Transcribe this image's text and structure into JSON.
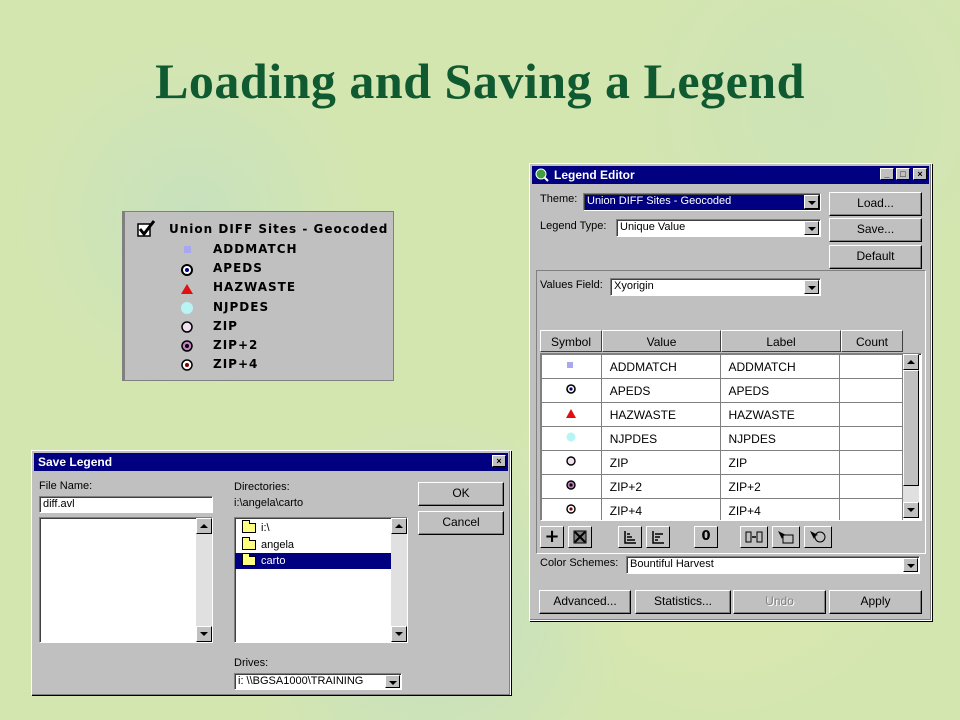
{
  "slide": {
    "title": "Loading and Saving a Legend"
  },
  "legend_display": {
    "title": "Union DIFF Sites - Geocoded",
    "items": [
      "ADDMATCH",
      "APEDS",
      "HAZWASTE",
      "NJPDES",
      "ZIP",
      "ZIP+2",
      "ZIP+4"
    ]
  },
  "legend_editor": {
    "window_title": "Legend Editor",
    "theme_label": "Theme:",
    "theme_value": "Union DIFF Sites - Geocoded",
    "legend_type_label": "Legend Type:",
    "legend_type_value": "Unique Value",
    "load_button": "Load...",
    "save_button": "Save...",
    "default_button": "Default",
    "values_field_label": "Values Field:",
    "values_field_value": "Xyorigin",
    "columns": [
      "Symbol",
      "Value",
      "Label",
      "Count"
    ],
    "rows": [
      {
        "value": "ADDMATCH",
        "label": "ADDMATCH",
        "count": ""
      },
      {
        "value": "APEDS",
        "label": "APEDS",
        "count": ""
      },
      {
        "value": "HAZWASTE",
        "label": "HAZWASTE",
        "count": ""
      },
      {
        "value": "NJPDES",
        "label": "NJPDES",
        "count": ""
      },
      {
        "value": "ZIP",
        "label": "ZIP",
        "count": ""
      },
      {
        "value": "ZIP+2",
        "label": "ZIP+2",
        "count": ""
      },
      {
        "value": "ZIP+4",
        "label": "ZIP+4",
        "count": ""
      }
    ],
    "tools": [
      "+",
      "0"
    ],
    "color_schemes_label": "Color Schemes:",
    "color_schemes_value": "Bountiful Harvest",
    "advanced_button": "Advanced...",
    "statistics_button": "Statistics...",
    "undo_button": "Undo",
    "apply_button": "Apply"
  },
  "save_legend": {
    "window_title": "Save Legend",
    "file_name_label": "File Name:",
    "file_name_value": "diff.avl",
    "directories_label": "Directories:",
    "current_dir": "i:\\angela\\carto",
    "dirs": [
      "i:\\",
      "angela",
      "carto"
    ],
    "ok_button": "OK",
    "cancel_button": "Cancel",
    "drives_label": "Drives:",
    "drive_value": "i: \\\\BGSA1000\\TRAINING"
  }
}
